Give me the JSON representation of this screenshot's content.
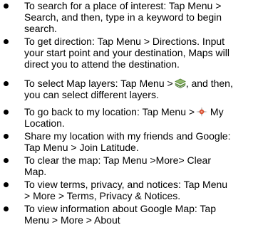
{
  "items": [
    {
      "lines": [
        {
          "text": "To search for a place of interest: Tap Menu >"
        },
        {
          "text": "Search, and then, type in a keyword to begin"
        },
        {
          "text": "search."
        }
      ]
    },
    {
      "lines": [
        {
          "text": "To get direction: Tap Menu > Directions. Input"
        },
        {
          "text": "your start point and your destination, Maps will"
        },
        {
          "text": "direct you to attend the destination."
        }
      ]
    },
    {
      "lines": [
        {
          "before": "To select Map layers: Tap Menu >",
          "icon": "layers-icon",
          "after": ", and then,"
        },
        {
          "text": "you can select different layers."
        }
      ]
    },
    {
      "lines": [
        {
          "before": "To go back to my location: Tap Menu >",
          "icon": "my-location-icon",
          "after": " My"
        },
        {
          "text": "Location."
        }
      ]
    },
    {
      "lines": [
        {
          "text": "Share my location with my friends and Google:"
        },
        {
          "text": "Tap Menu > Join Latitude."
        }
      ]
    },
    {
      "lines": [
        {
          "text": "To clear the map: Tap Menu >More> Clear"
        },
        {
          "text": "Map."
        }
      ]
    },
    {
      "lines": [
        {
          "text": "To view terms, privacy, and notices: Tap Menu"
        },
        {
          "text": "> More > Terms, Privacy & Notices."
        }
      ]
    },
    {
      "lines": [
        {
          "text": "To view information about Google Map: Tap"
        },
        {
          "text": "Menu > More > About"
        }
      ]
    }
  ]
}
